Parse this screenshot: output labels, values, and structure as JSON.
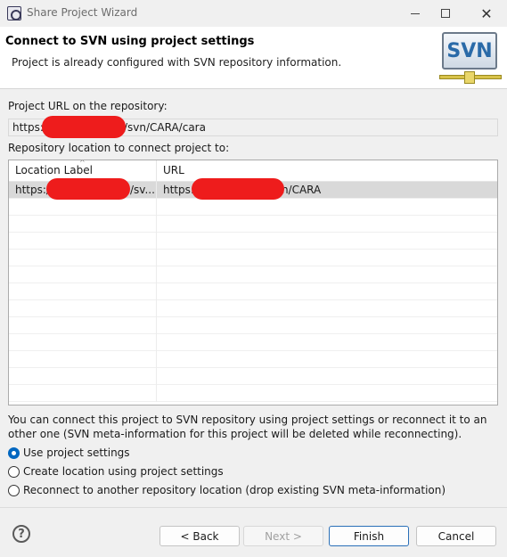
{
  "window": {
    "title": "Share Project Wizard"
  },
  "header": {
    "title": "Connect to SVN using project settings",
    "description": "Project is already configured with SVN repository information.",
    "logo_text": "SVN"
  },
  "project_url": {
    "label": "Project URL on the repository:",
    "value_prefix": "https:/",
    "value_suffix": "/svn/CARA/cara"
  },
  "repository": {
    "label": "Repository location to connect project to:",
    "columns": [
      "Location Label",
      "URL"
    ],
    "rows": [
      {
        "label_prefix": "https:/",
        "label_suffix": "/sv...",
        "url_prefix": "https:",
        "url_suffix": "n/CARA",
        "selected": true
      }
    ]
  },
  "info": {
    "text": "You can connect this project to SVN repository using project settings or reconnect it to an other one (SVN meta-information for this project will be deleted while reconnecting)."
  },
  "options": [
    {
      "label": "Use project settings",
      "checked": true
    },
    {
      "label": "Create location using project settings",
      "checked": false
    },
    {
      "label": "Reconnect to another repository location (drop existing SVN meta-information)",
      "checked": false
    }
  ],
  "footer": {
    "back": "< Back",
    "next": "Next >",
    "finish": "Finish",
    "cancel": "Cancel"
  },
  "colors": {
    "accent": "#0067c0",
    "redaction": "#ee1c1c",
    "selected_row": "#d9d9d9"
  }
}
